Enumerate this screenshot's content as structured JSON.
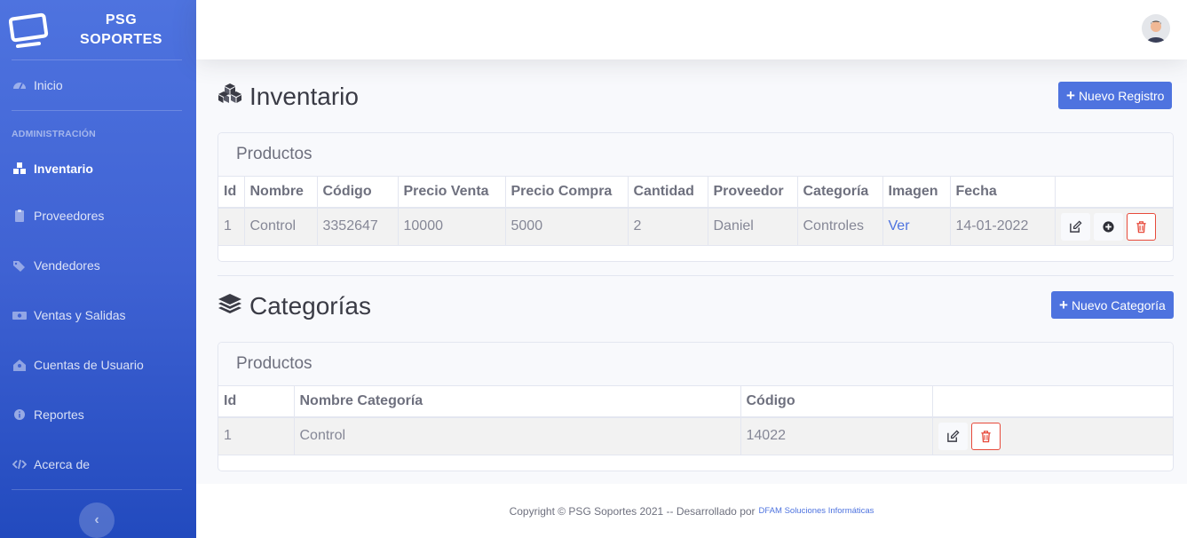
{
  "brand": {
    "line1": "PSG",
    "line2": "SOPORTES",
    "icon": "monitor-icon"
  },
  "sidebar": {
    "items": [
      {
        "label": "Inicio",
        "icon": "tachometer-icon"
      },
      {
        "label": "Inventario",
        "icon": "boxes-icon",
        "active": true
      },
      {
        "label": "Proveedores",
        "icon": "clipboard-icon"
      },
      {
        "label": "Vendedores",
        "icon": "tags-icon"
      },
      {
        "label": "Ventas y Salidas",
        "icon": "money-bill-icon"
      },
      {
        "label": "Cuentas de Usuario",
        "icon": "user-house-icon"
      },
      {
        "label": "Reportes",
        "icon": "info-circle-icon"
      },
      {
        "label": "Acerca de",
        "icon": "code-icon"
      }
    ],
    "heading": "ADMINISTRACIÓN",
    "toggle_label": "‹"
  },
  "inventario": {
    "title": "Inventario",
    "new_button": "Nuevo Registro",
    "card_title": "Productos",
    "columns": [
      "Id",
      "Nombre",
      "Código",
      "Precio Venta",
      "Precio Compra",
      "Cantidad",
      "Proveedor",
      "Categoría",
      "Imagen",
      "Fecha",
      ""
    ],
    "rows": [
      {
        "id": "1",
        "nombre": "Control",
        "codigo": "3352647",
        "precio_venta": "10000",
        "precio_compra": "5000",
        "cantidad": "2",
        "proveedor": "Daniel",
        "categoria": "Controles",
        "imagen": "Ver",
        "fecha": "14-01-2022"
      }
    ]
  },
  "categorias": {
    "title": "Categorías",
    "new_button": "Nuevo Categoría",
    "card_title": "Productos",
    "columns": [
      "Id",
      "Nombre Categoría",
      "Código",
      ""
    ],
    "rows": [
      {
        "id": "1",
        "nombre": "Control",
        "codigo": "14022"
      }
    ]
  },
  "footer": {
    "copyright": "Copyright © PSG Soportes 2021 -- Desarrollado por",
    "developer": "DFAM Soluciones Informáticas"
  },
  "colors": {
    "primary": "#4e73df",
    "danger": "#e74a3b",
    "sidebar_dark": "#224abe"
  }
}
